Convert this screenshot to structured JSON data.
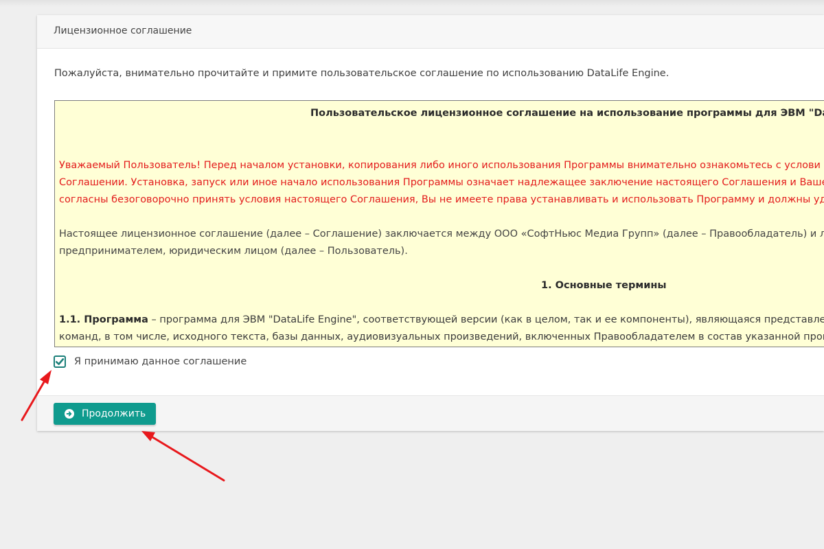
{
  "colors": {
    "page_background": "#efefef",
    "panel_background": "#ffffff",
    "license_background": "#ffffd6",
    "warning_text": "#e31c1c",
    "accent_teal": "#0f9b8e",
    "checkbox_border": "#1b7f79",
    "annotation_arrow": "#e8181c"
  },
  "panel": {
    "title": "Лицензионное соглашение"
  },
  "intro": "Пожалуйста, внимательно прочитайте и примите пользовательское соглашение по использованию DataLife Engine.",
  "license": {
    "title": "Пользовательское лицензионное соглашение на использование программы для ЭВМ \"Dat",
    "warning_lines": [
      "Уважаемый Пользователь! Перед началом установки, копирования либо иного использования Программы внимательно ознакомьтесь с услови",
      "Соглашении. Установка, запуск или иное начало использования Программы означает надлежащее заключение настоящего Соглашения и Ваше",
      "согласны безоговорочно принять условия настоящего Соглашения, Вы не имеете права устанавливать и использовать Программу и должны уд"
    ],
    "intro_lines": [
      "Настоящее лицензионное соглашение (далее – Соглашение) заключается между ООО «СофтНьюс Медиа Групп» (далее – Правообладатель) и л",
      "предпринимателем, юридическим лицом (далее – Пользователь)."
    ],
    "section_title": "1. Основные термины",
    "term": {
      "label": "1.1. Программа",
      "line1_rest": " – программа для ЭВМ \"DataLife Engine\", соответствующей версии (как в целом, так и ее компоненты), являющаяся представлен",
      "line2": "команд, в том числе, исходного текста, базы данных, аудиовизуальных произведений, включенных Правообладателем в состав указанной прог"
    }
  },
  "accept": {
    "checked": true,
    "label": "Я принимаю данное соглашение"
  },
  "footer": {
    "continue_button": {
      "label": "Продолжить",
      "icon": "arrow-circle-right-icon"
    }
  },
  "annotations": {
    "arrow_icon": "red-arrow-icon",
    "count": 2
  }
}
